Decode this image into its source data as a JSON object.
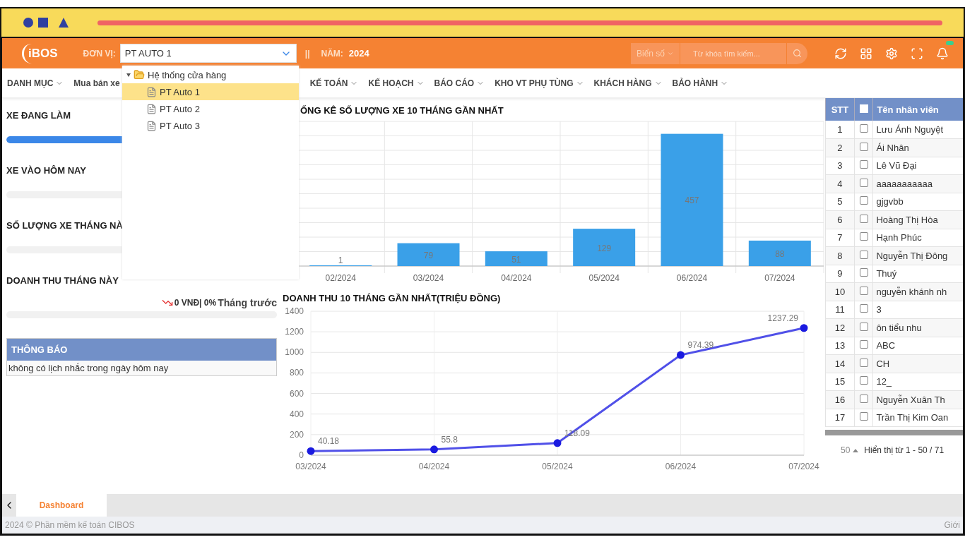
{
  "header": {
    "logo": "iBOS",
    "unit_label": "ĐƠN VỊ:",
    "unit_value": "PT AUTO 1",
    "separator": "||",
    "year_label": "NĂM:",
    "year_value": "2024",
    "search_scope": "Biển số",
    "search_placeholder": "Từ khóa tìm kiếm..."
  },
  "unit_dropdown": {
    "tree": [
      {
        "label": "Hệ thống cửa hàng",
        "expanded": true,
        "selected": false,
        "children": [
          {
            "label": "PT Auto 1",
            "selected": true
          },
          {
            "label": "PT Auto 2",
            "selected": false
          },
          {
            "label": "PT Auto 3",
            "selected": false
          }
        ]
      }
    ]
  },
  "menu": [
    {
      "label": "DANH MỤC",
      "caret": true
    },
    {
      "label": "Mua bán xe",
      "caret": false
    },
    {
      "label": "KẾ TOÁN",
      "caret": true
    },
    {
      "label": "KẾ HOẠCH",
      "caret": true
    },
    {
      "label": "BÁO CÁO",
      "caret": true
    },
    {
      "label": "KHO VT PHỤ TÙNG",
      "caret": true
    },
    {
      "label": "KHÁCH HÀNG",
      "caret": true
    },
    {
      "label": "BẢO HÀNH",
      "caret": true
    }
  ],
  "widgets": [
    {
      "title": "XE ĐANG LÀM",
      "level": 1
    },
    {
      "title": "XE VÀO HÔM NAY",
      "level": 0
    },
    {
      "title": "SỐ LƯỢNG XE THÁNG NÀ",
      "level": 0
    },
    {
      "title": "DOANH THU THÁNG NÀY",
      "level": 0,
      "trend": "0 VNĐ| 0%",
      "trend_suffix": "Tháng trước"
    }
  ],
  "notice": {
    "title": "THÔNG BÁO",
    "text": "không có lịch nhắc trong ngày hôm nay"
  },
  "bar_chart": {
    "title": "ỐNG KÊ SỐ LƯỢNG XE 10 THÁNG GẦN NHẤT",
    "chart_data": {
      "type": "bar",
      "categories": [
        "02/2024",
        "03/2024",
        "04/2024",
        "05/2024",
        "06/2024",
        "07/2024"
      ],
      "series": [
        {
          "color": "#3aa0e8",
          "values": [
            1,
            79,
            51,
            129,
            457,
            88
          ]
        }
      ],
      "data_labels": true,
      "grid": true
    }
  },
  "line_chart": {
    "title": "DOANH THU 10 THÁNG GẦN NHẤT(TRIỆU ĐỒNG)",
    "chart_data": {
      "type": "line",
      "categories": [
        "03/2024",
        "04/2024",
        "05/2024",
        "06/2024",
        "07/2024"
      ],
      "series": [
        {
          "color": "#5050e8",
          "values": [
            40,
            56,
            118,
            974,
            1237
          ],
          "marker": true
        }
      ],
      "ylim": [
        0,
        1400
      ],
      "yticks": [
        0,
        200,
        400,
        600,
        800,
        1000,
        1200,
        1400
      ],
      "value_labels": [
        "40.18",
        "55.8",
        "118.09",
        "974.39",
        "1237.29"
      ],
      "grid": true
    }
  },
  "staff_table": {
    "columns": [
      "STT",
      "",
      "Tên nhân viên"
    ],
    "header_checked": false,
    "rows": [
      {
        "stt": "1",
        "checked": false,
        "name": "Lưu Ánh Nguyệt"
      },
      {
        "stt": "2",
        "checked": false,
        "name": "Ái Nhân"
      },
      {
        "stt": "3",
        "checked": false,
        "name": "Lê Vũ Đại"
      },
      {
        "stt": "4",
        "checked": false,
        "name": "aaaaaaaaaaa"
      },
      {
        "stt": "5",
        "checked": false,
        "name": "gjgvbb"
      },
      {
        "stt": "6",
        "checked": false,
        "name": "Hoàng Thị Hòa"
      },
      {
        "stt": "7",
        "checked": false,
        "name": "Hạnh Phúc"
      },
      {
        "stt": "8",
        "checked": false,
        "name": "Nguyễn Thị Đông"
      },
      {
        "stt": "9",
        "checked": false,
        "name": "Thuý"
      },
      {
        "stt": "10",
        "checked": false,
        "name": "nguyễn khánh nh"
      },
      {
        "stt": "11",
        "checked": false,
        "name": "3"
      },
      {
        "stt": "12",
        "checked": false,
        "name": "ôn tiểu nhu"
      },
      {
        "stt": "13",
        "checked": false,
        "name": "ABC"
      },
      {
        "stt": "14",
        "checked": false,
        "name": "CH"
      },
      {
        "stt": "15",
        "checked": false,
        "name": "12_"
      },
      {
        "stt": "16",
        "checked": false,
        "name": "Nguyễn Xuân Th"
      },
      {
        "stt": "17",
        "checked": false,
        "name": "Trần Thị Kim Oan"
      }
    ],
    "page_size": "50",
    "page_info": "Hiển thị từ 1 - 50 / 71"
  },
  "tabs": [
    {
      "label": "Dashboard",
      "selected": true
    }
  ],
  "footer": {
    "text": "2024 © Phần mềm kế toán CIBOS",
    "right": "Giới"
  }
}
